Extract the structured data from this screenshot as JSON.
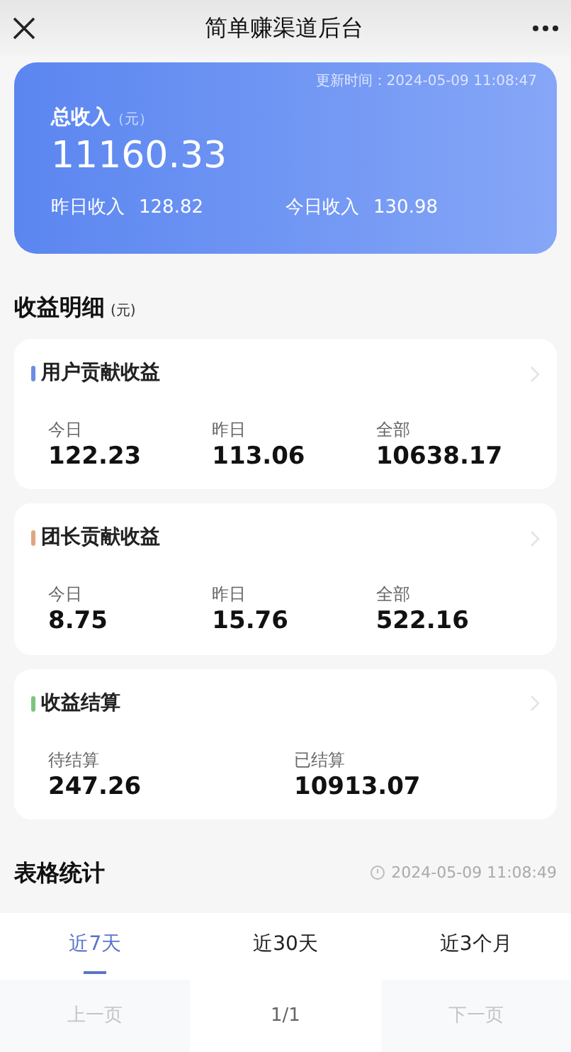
{
  "header": {
    "title": "简单赚渠道后台"
  },
  "summary": {
    "updated": "更新时间：2024-05-09 11:08:47",
    "label": "总收入",
    "unit": "（元）",
    "total": "11160.33",
    "stats": [
      {
        "label": "昨日收入",
        "value": "128.82"
      },
      {
        "label": "今日收入",
        "value": "130.98"
      }
    ]
  },
  "detail": {
    "title": "收益明细",
    "unit": "(元)"
  },
  "cards": [
    {
      "title": "用户贡献收益",
      "color": "#6b8de3",
      "items": [
        {
          "label": "今日",
          "value": "122.23"
        },
        {
          "label": "昨日",
          "value": "113.06"
        },
        {
          "label": "全部",
          "value": "10638.17"
        }
      ]
    },
    {
      "title": "团长贡献收益",
      "color": "#e3a57f",
      "items": [
        {
          "label": "今日",
          "value": "8.75"
        },
        {
          "label": "昨日",
          "value": "15.76"
        },
        {
          "label": "全部",
          "value": "522.16"
        }
      ]
    },
    {
      "title": "收益结算",
      "color": "#7cc57e",
      "items": [
        {
          "label": "待结算",
          "value": "247.26"
        },
        {
          "label": "已结算",
          "value": "10913.07"
        }
      ]
    }
  ],
  "stats_section": {
    "title": "表格统计",
    "time": "2024-05-09 11:08:49"
  },
  "tabs": [
    {
      "label": "近7天",
      "selected": true
    },
    {
      "label": "近30天",
      "selected": false
    },
    {
      "label": "近3个月",
      "selected": false
    }
  ],
  "pager": [
    {
      "label": "上一页",
      "kind": "button",
      "disabled": true
    },
    {
      "label": "1/1",
      "kind": "page"
    },
    {
      "label": "下一页",
      "kind": "button",
      "disabled": true
    }
  ]
}
